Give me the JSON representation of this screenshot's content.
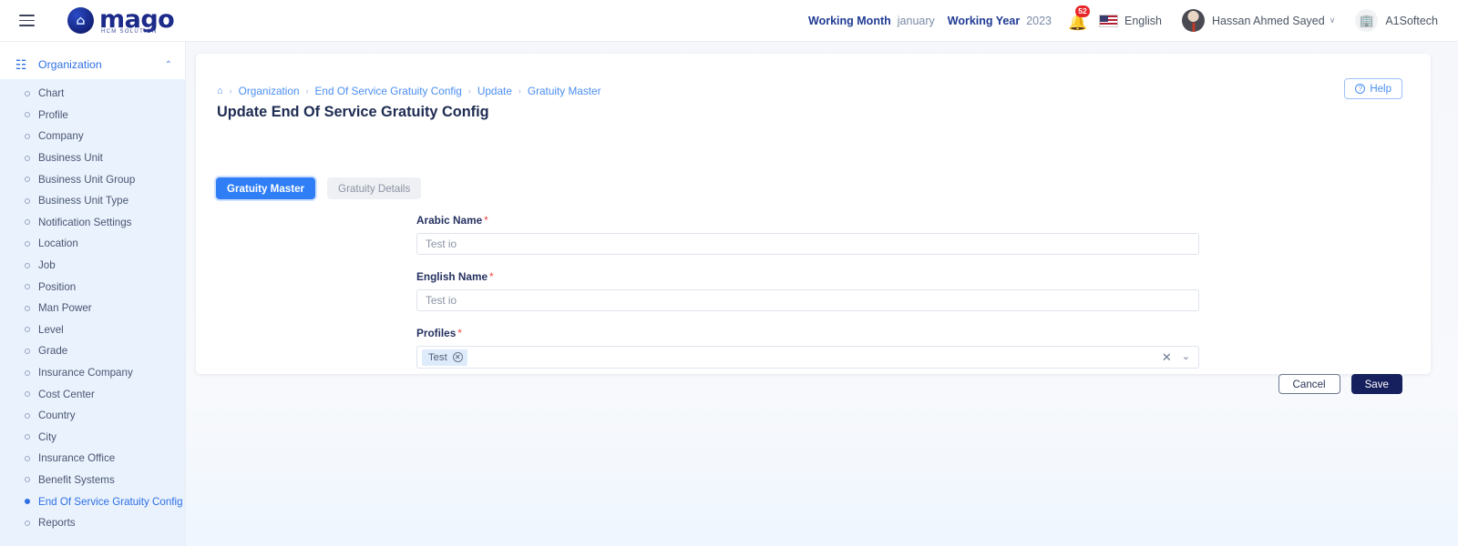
{
  "topbar": {
    "menu_icon": "hamburger-icon",
    "brand": {
      "name": "mago",
      "tagline": "HCM SOLUTION",
      "mark_glyph": "⌂"
    },
    "working_month_label": "Working Month",
    "working_month_value": "january",
    "working_year_label": "Working Year",
    "working_year_value": "2023",
    "notifications": {
      "icon": "bell-icon",
      "badge_count": "52"
    },
    "language": {
      "flag": "us-flag-icon",
      "label": "English"
    },
    "user": {
      "name": "Hassan Ahmed Sayed",
      "caret": "∨",
      "avatar": "user-avatar"
    },
    "company": {
      "name": "A1Softech",
      "icon": "building-icon"
    }
  },
  "sidebar": {
    "section": {
      "label": "Organization",
      "icon": "org-chart-icon",
      "chevron": "⌃"
    },
    "items": [
      {
        "label": "Chart",
        "active": false
      },
      {
        "label": "Profile",
        "active": false
      },
      {
        "label": "Company",
        "active": false
      },
      {
        "label": "Business Unit",
        "active": false
      },
      {
        "label": "Business Unit Group",
        "active": false
      },
      {
        "label": "Business Unit Type",
        "active": false
      },
      {
        "label": "Notification Settings",
        "active": false
      },
      {
        "label": "Location",
        "active": false
      },
      {
        "label": "Job",
        "active": false
      },
      {
        "label": "Position",
        "active": false
      },
      {
        "label": "Man Power",
        "active": false
      },
      {
        "label": "Level",
        "active": false
      },
      {
        "label": "Grade",
        "active": false
      },
      {
        "label": "Insurance Company",
        "active": false
      },
      {
        "label": "Cost Center",
        "active": false
      },
      {
        "label": "Country",
        "active": false
      },
      {
        "label": "City",
        "active": false
      },
      {
        "label": "Insurance Office",
        "active": false
      },
      {
        "label": "Benefit Systems",
        "active": false
      },
      {
        "label": "End Of Service Gratuity Config",
        "active": true
      },
      {
        "label": "Reports",
        "active": false
      }
    ]
  },
  "page": {
    "help_button": "Help",
    "breadcrumb": [
      "Organization",
      "End Of Service Gratuity Config",
      "Update",
      "Gratuity Master"
    ],
    "title": "Update End Of Service Gratuity Config",
    "tabs": [
      {
        "label": "Gratuity Master",
        "active": true
      },
      {
        "label": "Gratuity Details",
        "active": false
      }
    ],
    "form": {
      "arabic_name": {
        "label": "Arabic Name",
        "required": "*",
        "value": "",
        "placeholder": "Test io"
      },
      "english_name": {
        "label": "English Name",
        "required": "*",
        "value": "",
        "placeholder": "Test io"
      },
      "profiles": {
        "label": "Profiles",
        "required": "*",
        "chips": [
          "Test"
        ],
        "clear_icon": "✕",
        "chevron_icon": "⌄"
      }
    },
    "buttons": {
      "cancel": "Cancel",
      "save": "Save"
    }
  },
  "colors": {
    "accent_blue": "#2f7ef5",
    "link_blue": "#4b8ef0",
    "save_navy": "#16205e",
    "required_red": "#ef4444",
    "badge_red": "#e8272c",
    "sidebar_active_bg": "#e9f2fd"
  }
}
